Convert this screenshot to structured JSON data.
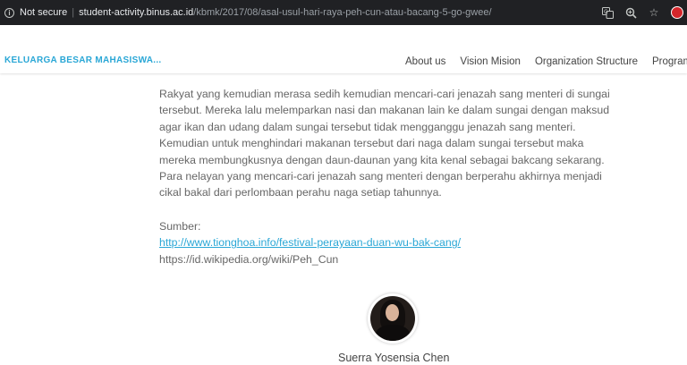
{
  "browser": {
    "security_label": "Not secure",
    "host": "student-activity.binus.ac.id",
    "path": "/kbmk/2017/08/asal-usul-hari-raya-peh-cun-atau-bacang-5-go-gwee/",
    "icons": [
      "info-icon",
      "translate-icon",
      "zoom-icon",
      "bookmark-star-icon",
      "extension-icon"
    ]
  },
  "site": {
    "brand": "KELUARGA BESAR MAHASISWA...",
    "nav": [
      "About us",
      "Vision Mision",
      "Organization Structure",
      "Programs"
    ]
  },
  "article": {
    "lines": [
      "Rakyat yang kemudian merasa sedih kemudian mencari-cari jenazah sang menteri di sungai",
      "tersebut. Mereka lalu melemparkan nasi dan makanan lain ke dalam sungai dengan maksud",
      "agar ikan dan udang dalam sungai tersebut tidak mengganggu jenazah sang menteri.",
      "Kemudian untuk menghindari makanan tersebut dari naga dalam sungai tersebut maka",
      "mereka membungkusnya dengan daun-daunan yang kita kenal sebagai bakcang sekarang.",
      "Para nelayan yang mencari-cari jenazah sang menteri dengan berperahu akhirnya menjadi",
      "cikal bakal dari perlombaan perahu naga setiap tahunnya."
    ],
    "source_label": "Sumber:",
    "source_link": "http://www.tionghoa.info/festival-perayaan-duan-wu-bak-cang/",
    "source_text": "https://id.wikipedia.org/wiki/Peh_Cun"
  },
  "author": {
    "name": "Suerra Yosensia Chen"
  }
}
